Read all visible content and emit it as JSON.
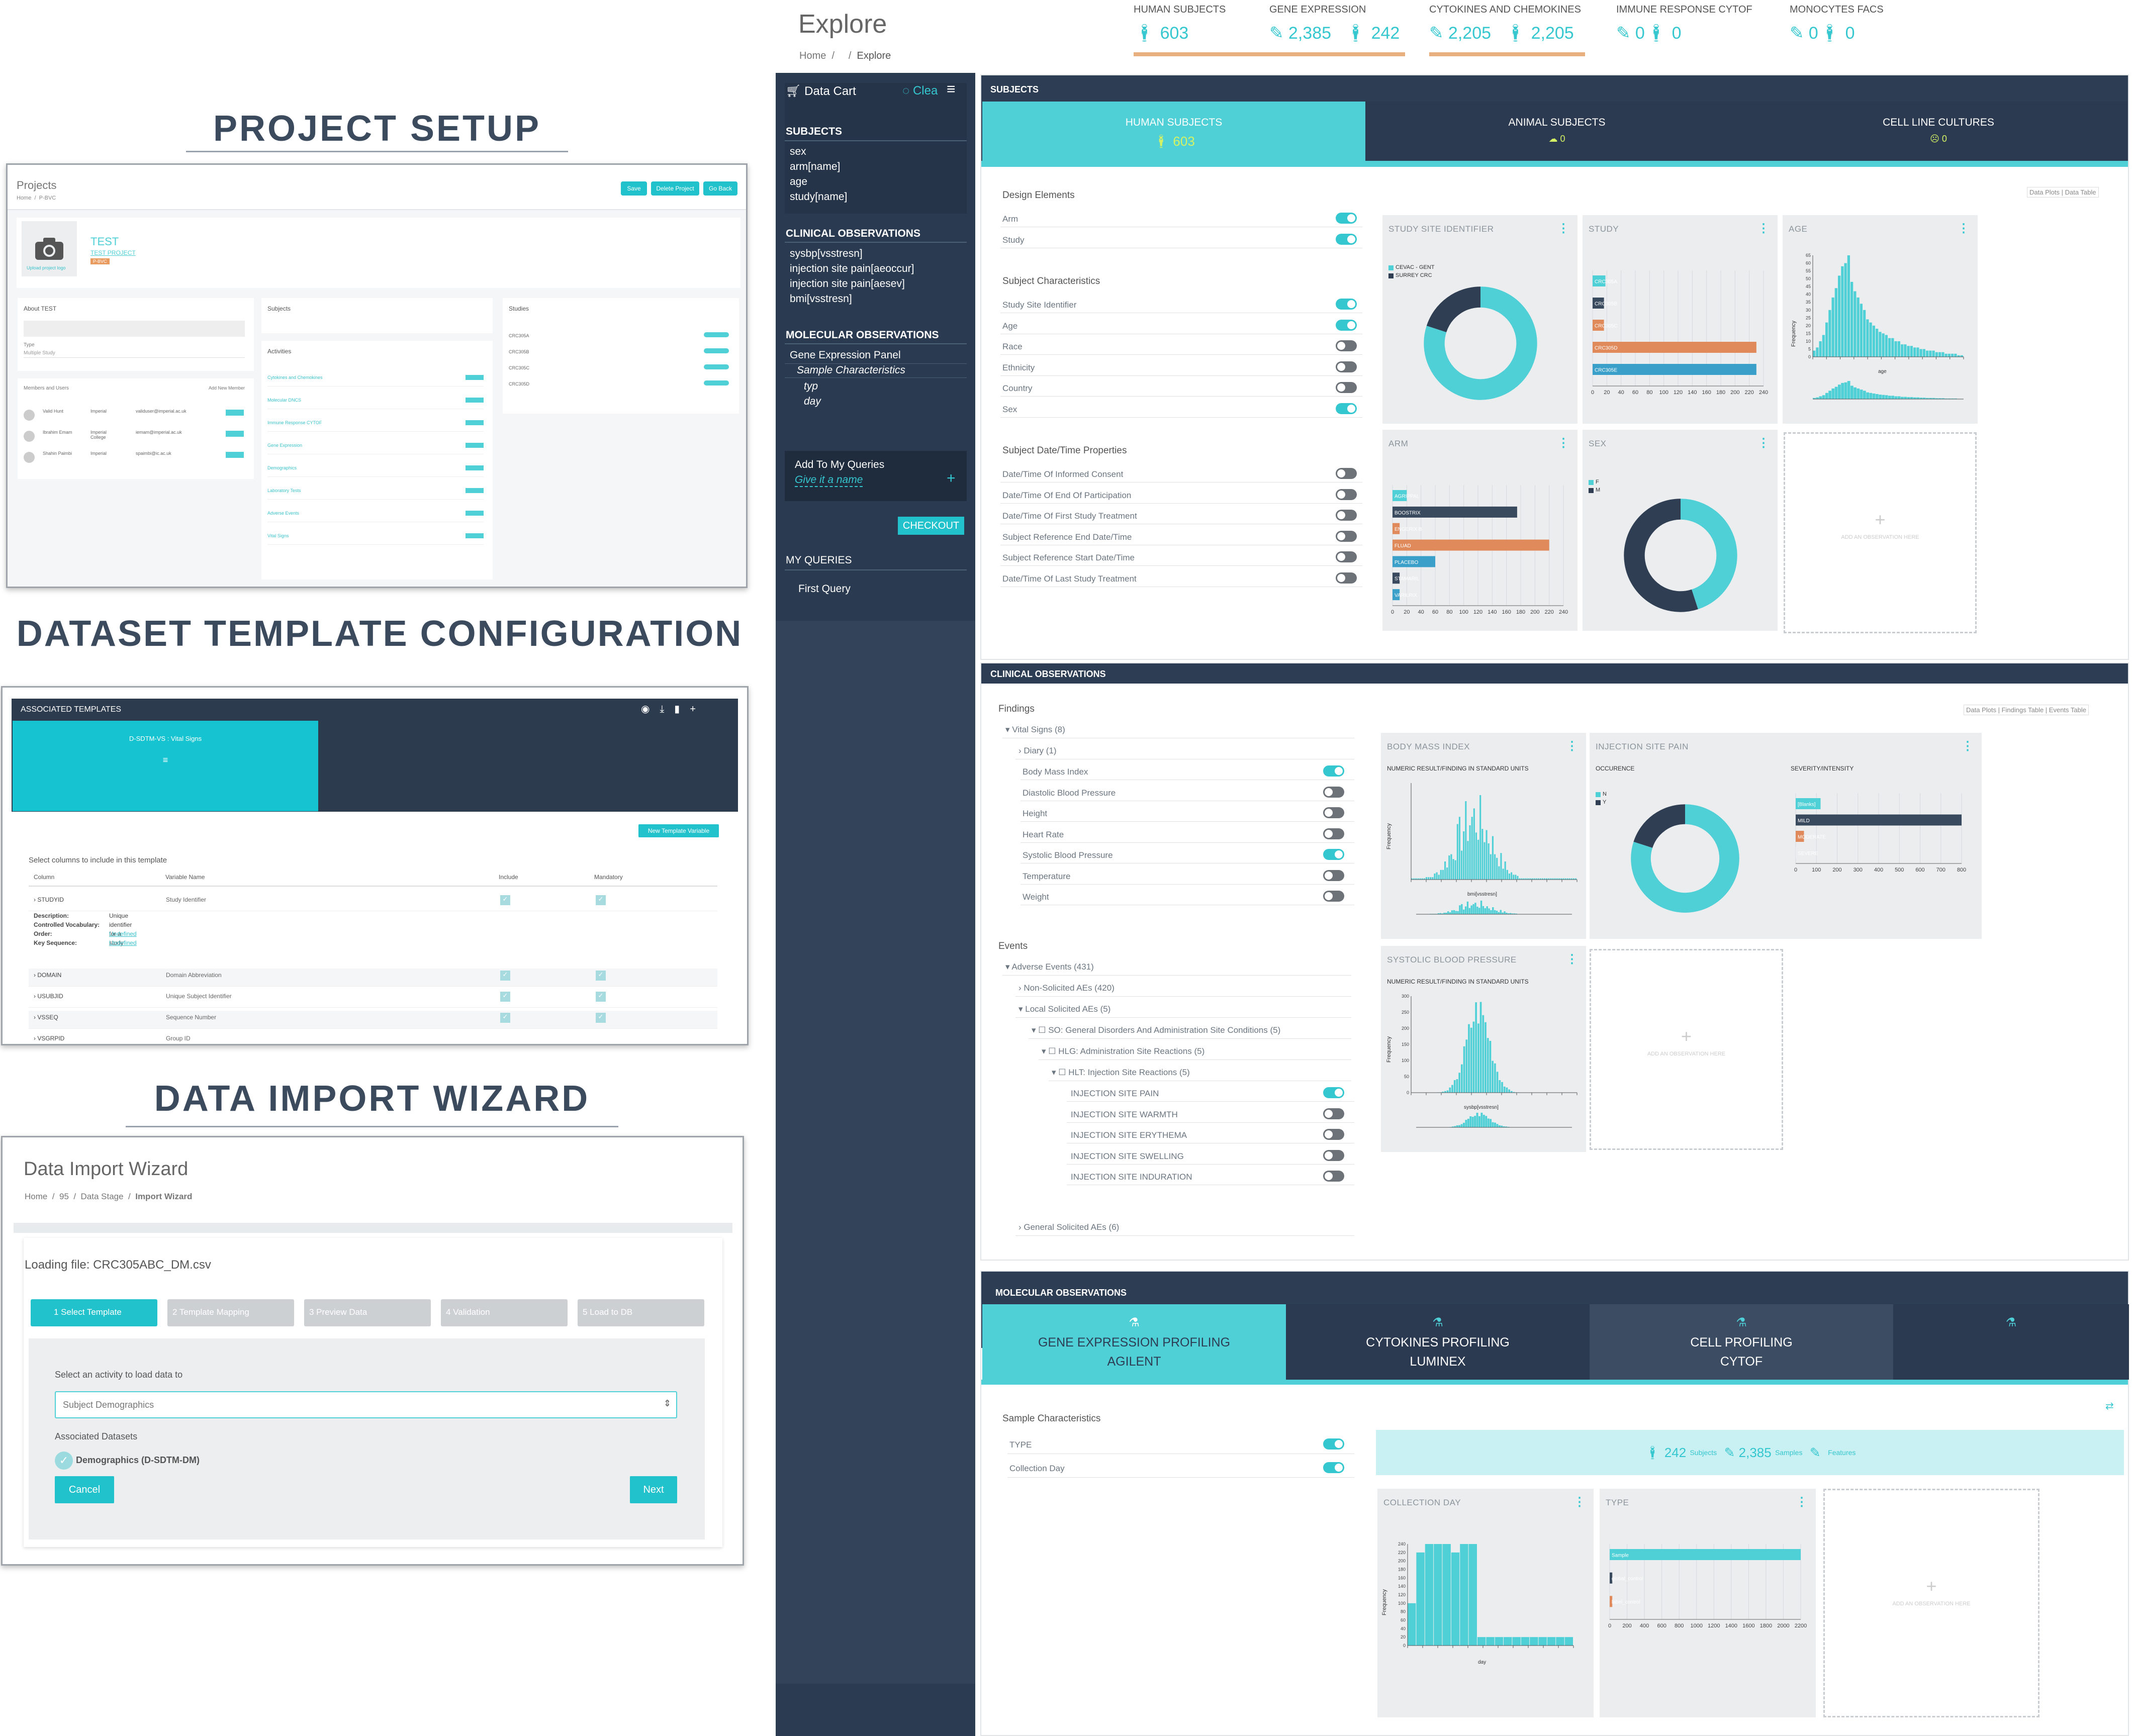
{
  "sections": {
    "project_setup": "PROJECT SETUP",
    "dataset_template": "DATASET TEMPLATE CONFIGURATION",
    "data_import": "DATA IMPORT WIZARD"
  },
  "project": {
    "header": "Projects",
    "breadcrumb": [
      "Home",
      "P-BVC"
    ],
    "buttons": [
      "Save",
      "Delete Project",
      "Go Back"
    ],
    "name": "TEST",
    "subname": "TEST PROJECT",
    "badge": "P-BVC",
    "upload": "Upload project logo",
    "about": "About TEST",
    "subjects": "Subjects",
    "studies": "Studies",
    "activities": "Activities",
    "members": "Members and Users",
    "add_member": "Add New Member",
    "type_label": "Type",
    "type_value": "Multiple Study",
    "study_list": [
      "CRC305A",
      "CRC305B",
      "CRC305C",
      "CRC305D"
    ],
    "activity_list": [
      "Cytokines and Chemokines",
      "Molecular DNCS",
      "Immune Response CYTOF",
      "Gene Expression",
      "Demographics",
      "Laboratory Tests",
      "Adverse Events",
      "Vital Signs"
    ],
    "member_list": [
      {
        "name": "Valid Hunt",
        "org": "Imperial",
        "email": "validuser@imperial.ac.uk"
      },
      {
        "name": "Ibrahim Emam",
        "org": "Imperial College",
        "email": "iemam@imperial.ac.uk"
      },
      {
        "name": "Shahin Paimbi",
        "org": "Imperial",
        "email": "spaimbi@ic.ac.uk"
      }
    ]
  },
  "template": {
    "header": "ASSOCIATED TEMPLATES",
    "tab": "D-SDTM-VS : Vital Signs",
    "new_button": "New Template Variable",
    "instruction": "Select columns to include in this template",
    "columns": [
      "Column",
      "Variable Name",
      "Include",
      "Mandatory"
    ],
    "rows": [
      {
        "col": "STUDYID",
        "var": "Study Identifier"
      },
      {
        "col": "DOMAIN",
        "var": "Domain Abbreviation"
      },
      {
        "col": "USUBJID",
        "var": "Unique Subject Identifier"
      },
      {
        "col": "VSSEQ",
        "var": "Sequence Number"
      },
      {
        "col": "VSGRPID",
        "var": "Group ID"
      }
    ],
    "detail_labels": [
      "Description:",
      "Controlled Vocabulary:",
      "Order:",
      "Key Sequence:"
    ],
    "detail_values": [
      "Unique identifier for a study",
      "",
      "Undefined",
      "Undefined"
    ]
  },
  "wizard": {
    "title": "Data Import Wizard",
    "breadcrumb": [
      "Home",
      "95",
      "Data Stage",
      "Import Wizard"
    ],
    "loading": "Loading file: CRC305ABC_DM.csv",
    "steps": [
      "1 Select Template",
      "2 Template Mapping",
      "3 Preview Data",
      "4 Validation",
      "5 Load to DB"
    ],
    "select_label": "Select an activity to load data to",
    "select_value": "Subject Demographics",
    "assoc_label": "Associated Datasets",
    "assoc_item": "Demographics (D-SDTM-DM)",
    "cancel": "Cancel",
    "next": "Next"
  },
  "explore": {
    "title": "Explore",
    "breadcrumb": [
      "Home",
      "Explore"
    ],
    "stats": [
      {
        "label": "HUMAN SUBJECTS",
        "values": [
          "603"
        ]
      },
      {
        "label": "GENE EXPRESSION",
        "values": [
          "2,385",
          "242"
        ]
      },
      {
        "label": "CYTOKINES AND CHEMOKINES",
        "values": [
          "2,205",
          "2,205"
        ]
      },
      {
        "label": "IMMUNE RESPONSE CYTOF",
        "values": [
          "0",
          "0"
        ]
      },
      {
        "label": "MONOCYTES FACS",
        "values": [
          "0",
          "0"
        ]
      }
    ]
  },
  "cart": {
    "title": "Data Cart",
    "clear": "Clea",
    "subjects_h": "SUBJECTS",
    "subjects": [
      "sex",
      "arm[name]",
      "age",
      "study[name]"
    ],
    "clinical_h": "CLINICAL OBSERVATIONS",
    "clinical": [
      "sysbp[vsstresn]",
      "injection site pain[aeoccur]",
      "injection site pain[aesev]",
      "bmi[vsstresn]"
    ],
    "molecular_h": "MOLECULAR OBSERVATIONS",
    "molecular": [
      "Gene Expression Panel",
      "Sample Characteristics",
      "typ",
      "day"
    ],
    "add_queries": "Add To My Queries",
    "give_name": "Give it a name",
    "checkout": "CHECKOUT",
    "my_queries": "MY QUERIES",
    "first_query": "First Query"
  },
  "subjects_panel": {
    "header": "SUBJECTS",
    "tabs": [
      {
        "label": "HUMAN SUBJECTS",
        "count": "603"
      },
      {
        "label": "ANIMAL SUBJECTS",
        "count": "0"
      },
      {
        "label": "CELL LINE CULTURES",
        "count": "0"
      }
    ],
    "view_buttons": [
      "Data Plots",
      "Data Table"
    ],
    "groups": [
      {
        "title": "Design Elements",
        "items": [
          {
            "label": "Arm",
            "on": true
          },
          {
            "label": "Study",
            "on": true
          }
        ]
      },
      {
        "title": "Subject Characteristics",
        "items": [
          {
            "label": "Study Site Identifier",
            "on": true
          },
          {
            "label": "Age",
            "on": true
          },
          {
            "label": "Race",
            "on": false
          },
          {
            "label": "Ethnicity",
            "on": false
          },
          {
            "label": "Country",
            "on": false
          },
          {
            "label": "Sex",
            "on": true
          }
        ]
      },
      {
        "title": "Subject Date/Time Properties",
        "items": [
          {
            "label": "Date/Time Of Informed Consent",
            "on": false
          },
          {
            "label": "Date/Time Of End Of Participation",
            "on": false
          },
          {
            "label": "Date/Time Of First Study Treatment",
            "on": false
          },
          {
            "label": "Subject Reference End Date/Time",
            "on": false
          },
          {
            "label": "Subject Reference Start Date/Time",
            "on": false
          },
          {
            "label": "Date/Time Of Last Study Treatment",
            "on": false
          }
        ]
      }
    ],
    "cards": [
      "STUDY SITE IDENTIFIER",
      "STUDY",
      "AGE",
      "ARM",
      "SEX"
    ],
    "add_obs": "ADD AN OBSERVATION HERE",
    "site_legend": [
      "CEVAC - GENT",
      "SURREY CRC"
    ],
    "sex_legend": [
      "F",
      "M"
    ]
  },
  "clinical_panel": {
    "header": "CLINICAL OBSERVATIONS",
    "view_buttons": [
      "Data Plots",
      "Findings Table",
      "Events Table"
    ],
    "findings": "Findings",
    "vital_signs": "Vital Signs (8)",
    "diary": "Diary (1)",
    "vitals": [
      {
        "label": "Body Mass Index",
        "on": true
      },
      {
        "label": "Diastolic Blood Pressure",
        "on": false
      },
      {
        "label": "Height",
        "on": false
      },
      {
        "label": "Heart Rate",
        "on": false
      },
      {
        "label": "Systolic Blood Pressure",
        "on": true
      },
      {
        "label": "Temperature",
        "on": false
      },
      {
        "label": "Weight",
        "on": false
      }
    ],
    "events": "Events",
    "adverse": "Adverse Events (431)",
    "non_solicited": "Non-Solicited AEs (420)",
    "local_solicited": "Local Solicited AEs (5)",
    "so": "SO: General Disorders And Administration Site Conditions (5)",
    "hlg": "HLG: Administration Site Reactions (5)",
    "hlt": "HLT: Injection Site Reactions (5)",
    "injection": [
      {
        "label": "INJECTION SITE PAIN",
        "on": true
      },
      {
        "label": "INJECTION SITE WARMTH",
        "on": false
      },
      {
        "label": "INJECTION SITE ERYTHEMA",
        "on": false
      },
      {
        "label": "INJECTION SITE SWELLING",
        "on": false
      },
      {
        "label": "INJECTION SITE INDURATION",
        "on": false
      }
    ],
    "general_solicited": "General Solicited AEs (6)",
    "cards": [
      "BODY MASS INDEX",
      "INJECTION SITE PAIN",
      "SYSTOLIC BLOOD PRESSURE"
    ],
    "numeric_label": "NUMERIC RESULT/FINDING IN STANDARD UNITS",
    "occurence": "OCCURENCE",
    "severity": "SEVERITY/INTENSITY",
    "bmi_xlabel": "bmi[vsstresn]",
    "sbp_xlabel": "sysbp[vsstresn]",
    "occ_legend": [
      "N",
      "Y"
    ],
    "sev_categories": [
      "[Blanks]",
      "MILD",
      "MODERATE",
      "SEVERE"
    ]
  },
  "molecular_panel": {
    "header": "MOLECULAR OBSERVATIONS",
    "tabs": [
      {
        "line1": "GENE EXPRESSION PROFILING",
        "line2": "AGILENT"
      },
      {
        "line1": "CYTOKINES PROFILING",
        "line2": "LUMINEX"
      },
      {
        "line1": "CELL PROFILING",
        "line2": "CYTOF"
      }
    ],
    "sample_chars": "Sample Characteristics",
    "items": [
      {
        "label": "TYPE",
        "on": true
      },
      {
        "label": "Collection Day",
        "on": true
      }
    ],
    "summary": {
      "subjects": "242",
      "subjects_label": "Subjects",
      "samples": "2,385",
      "samples_label": "Samples",
      "features_label": "Features"
    },
    "cards": [
      "COLLECTION DAY",
      "TYPE"
    ],
    "day_xlabel": "day",
    "type_categories": [
      "Sample",
      "global_control",
      "label_control"
    ]
  },
  "freq_label": "Frequency",
  "chart_data": [
    {
      "type": "pie",
      "title": "STUDY SITE IDENTIFIER",
      "categories": [
        "CEVAC - GENT",
        "SURREY CRC"
      ],
      "values": [
        80,
        20
      ]
    },
    {
      "type": "bar",
      "title": "STUDY",
      "categories": [
        "CRC305A",
        "CRC305B",
        "CRC305C",
        "CRC305D",
        "CRC305E"
      ],
      "values": [
        18,
        16,
        16,
        230,
        230
      ],
      "xlim": [
        0,
        240
      ],
      "ticks": [
        0,
        20,
        40,
        60,
        80,
        100,
        120,
        140,
        160,
        180,
        200,
        220,
        240
      ]
    },
    {
      "type": "bar",
      "title": "AGE",
      "ylabel": "Frequency",
      "xlabel": "age",
      "values": [
        4,
        6,
        10,
        14,
        22,
        30,
        38,
        44,
        52,
        58,
        60,
        65,
        48,
        42,
        38,
        34,
        30,
        24,
        22,
        20,
        18,
        16,
        15,
        14,
        12,
        12,
        10,
        10,
        8,
        8,
        7,
        7,
        6,
        6,
        5,
        5,
        4,
        4,
        4,
        3,
        3,
        3,
        2,
        2,
        2,
        2,
        1,
        1
      ],
      "ylim": [
        0,
        65
      ],
      "yticks": [
        0,
        5,
        10,
        15,
        20,
        25,
        30,
        35,
        40,
        45,
        50,
        55,
        60,
        65
      ]
    },
    {
      "type": "bar",
      "title": "ARM",
      "categories": [
        "AGRIPPAL",
        "BOOSTRIX",
        "ENGERIX B",
        "FLUAD",
        "PLACEBO",
        "STAMARIL",
        "VARILRIX"
      ],
      "values": [
        20,
        175,
        10,
        220,
        60,
        10,
        10
      ],
      "xlim": [
        0,
        240
      ],
      "ticks": [
        0,
        20,
        40,
        60,
        80,
        100,
        120,
        140,
        160,
        180,
        200,
        220,
        240
      ]
    },
    {
      "type": "pie",
      "title": "SEX",
      "categories": [
        "F",
        "M"
      ],
      "values": [
        45,
        55
      ]
    },
    {
      "type": "bar",
      "title": "BODY MASS INDEX",
      "ylabel": "Frequency"
    },
    {
      "type": "pie",
      "title": "INJECTION SITE PAIN OCCURENCE",
      "categories": [
        "N",
        "Y"
      ],
      "values": [
        80,
        20
      ]
    },
    {
      "type": "bar",
      "title": "INJECTION SITE PAIN SEVERITY/INTENSITY",
      "categories": [
        "[Blanks]",
        "MILD",
        "MODERATE",
        "SEVERE"
      ],
      "values": [
        120,
        800,
        40,
        0
      ],
      "xlim": [
        0,
        800
      ],
      "ticks": [
        0,
        100,
        200,
        300,
        400,
        500,
        600,
        700,
        800
      ]
    },
    {
      "type": "bar",
      "title": "SYSTOLIC BLOOD PRESSURE",
      "ylabel": "Frequency",
      "ylim": [
        0,
        300
      ],
      "yticks": [
        0,
        50,
        100,
        150,
        200,
        250,
        300
      ]
    },
    {
      "type": "bar",
      "title": "COLLECTION DAY",
      "ylabel": "Frequency",
      "xlabel": "day",
      "values": [
        100,
        220,
        240,
        240,
        240,
        220,
        240,
        240,
        20,
        20,
        20,
        20,
        20,
        20,
        20,
        20,
        20,
        20,
        20
      ],
      "ylim": [
        0,
        240
      ],
      "yticks": [
        0,
        20,
        40,
        60,
        80,
        100,
        120,
        140,
        160,
        180,
        200,
        220,
        240
      ]
    },
    {
      "type": "bar",
      "title": "TYPE",
      "categories": [
        "Sample",
        "global_control",
        "label_control"
      ],
      "values": [
        2200,
        30,
        30
      ],
      "xlim": [
        0,
        2200
      ],
      "ticks": [
        0,
        200,
        400,
        600,
        800,
        1000,
        1200,
        1400,
        1600,
        1800,
        2000,
        2200
      ]
    }
  ],
  "colors": {
    "teal": "#4fcfd6",
    "navy": "#324359",
    "orange": "#e0895a",
    "dark": "#3a4a5e",
    "blue": "#3aa0c9"
  }
}
